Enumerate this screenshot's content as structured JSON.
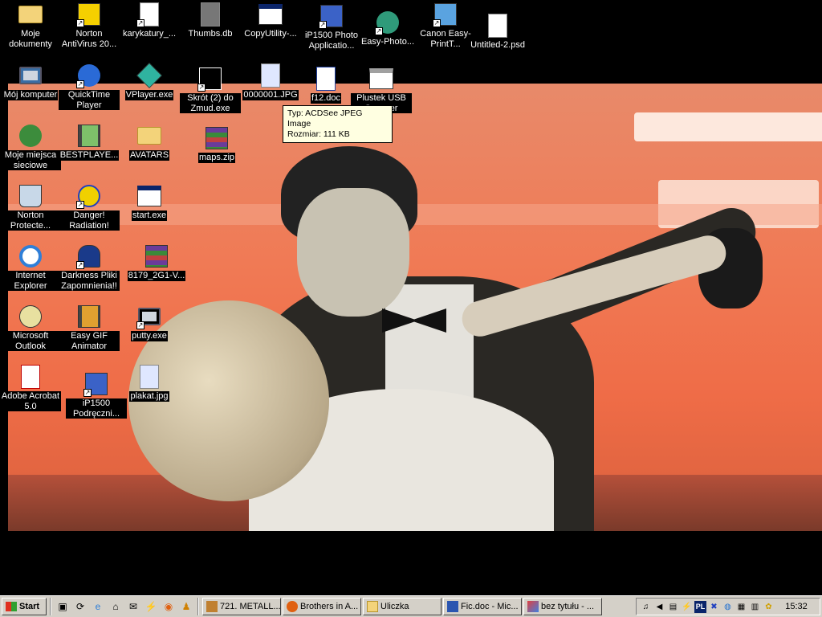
{
  "desktop": {
    "icons": [
      {
        "label": "Moje dokumenty",
        "icon": "folder-documents-icon"
      },
      {
        "label": "Norton AntiVirus 20...",
        "icon": "norton-antivirus-icon"
      },
      {
        "label": "karykatury_...",
        "icon": "document-icon"
      },
      {
        "label": "Thumbs.db",
        "icon": "db-file-icon"
      },
      {
        "label": "CopyUtility-...",
        "icon": "application-icon"
      },
      {
        "label": "iP1500 Photo Applicatio...",
        "icon": "help-book-icon"
      },
      {
        "label": "Easy-Photo...",
        "icon": "easy-photo-icon"
      },
      {
        "label": "Canon Easy-PrintT...",
        "icon": "canon-print-icon"
      },
      {
        "label": "Untitled-2.psd",
        "icon": "psd-file-icon"
      },
      {
        "label": "Mój komputer",
        "icon": "my-computer-icon"
      },
      {
        "label": "QuickTime Player",
        "icon": "quicktime-icon"
      },
      {
        "label": "VPlayer.exe",
        "icon": "vplayer-icon"
      },
      {
        "label": "Skrót (2) do Zmud.exe",
        "icon": "zmud-icon"
      },
      {
        "label": "0000001.JPG",
        "icon": "jpeg-file-icon"
      },
      {
        "label": "f12.doc",
        "icon": "word-doc-icon"
      },
      {
        "label": "Plustek USB Scanner",
        "icon": "scanner-icon"
      },
      {
        "label": "Moje miejsca sieciowe",
        "icon": "network-places-icon"
      },
      {
        "label": "BESTPLAYE...",
        "icon": "film-icon"
      },
      {
        "label": "AVATARS",
        "icon": "folder-icon"
      },
      {
        "label": "maps.zip",
        "icon": "winrar-archive-icon"
      },
      {
        "label": "Norton Protecte...",
        "icon": "recycle-bin-icon"
      },
      {
        "label": "Danger! Radiation!",
        "icon": "radiation-icon"
      },
      {
        "label": "start.exe",
        "icon": "window-app-icon"
      },
      {
        "label": "Internet Explorer",
        "icon": "internet-explorer-icon"
      },
      {
        "label": "Darkness Pliki Zapomnienia!!",
        "icon": "darkness-icon"
      },
      {
        "label": "8179_2G1-V...",
        "icon": "winrar-archive-icon"
      },
      {
        "label": "Microsoft Outlook",
        "icon": "outlook-icon"
      },
      {
        "label": "Easy GIF Animator",
        "icon": "film-icon"
      },
      {
        "label": "putty.exe",
        "icon": "putty-icon"
      },
      {
        "label": "Adobe Acrobat 5.0",
        "icon": "acrobat-icon"
      },
      {
        "label": "iP1500 Podręczni...",
        "icon": "help-book-icon"
      },
      {
        "label": "plakat.jpg",
        "icon": "jpeg-file-icon"
      }
    ]
  },
  "tooltip": {
    "line1": "Typ: ACDSee JPEG Image",
    "line2": "Rozmiar: 111 KB"
  },
  "taskbar": {
    "start_label": "Start",
    "quick_launch": [
      "show-desktop-icon",
      "sync-icon",
      "internet-explorer-icon",
      "network-icon",
      "outlook-express-icon",
      "winamp-icon",
      "firefox-icon",
      "aim-icon"
    ],
    "tasks": [
      {
        "label": "721. METALL...",
        "icon": "winamp-icon"
      },
      {
        "label": "Brothers in A...",
        "icon": "firefox-icon"
      },
      {
        "label": "Uliczka",
        "icon": "folder-icon"
      },
      {
        "label": "Fic.doc - Mic...",
        "icon": "word-icon"
      },
      {
        "label": "bez tytułu - ...",
        "icon": "paint-icon"
      }
    ],
    "tray": {
      "language": "PL",
      "icons": [
        "speaker-icon",
        "volume-icon",
        "network-monitor-icon",
        "power-icon",
        "display-icon",
        "bluetooth-icon",
        "antivirus-icon",
        "task-icon",
        "gg-icon"
      ],
      "clock": "15:32"
    }
  },
  "colors": {
    "taskbar": "#d4d0c8",
    "tooltip_bg": "#ffffe1",
    "label_bg": "#000000",
    "label_text": "#ffffff"
  }
}
